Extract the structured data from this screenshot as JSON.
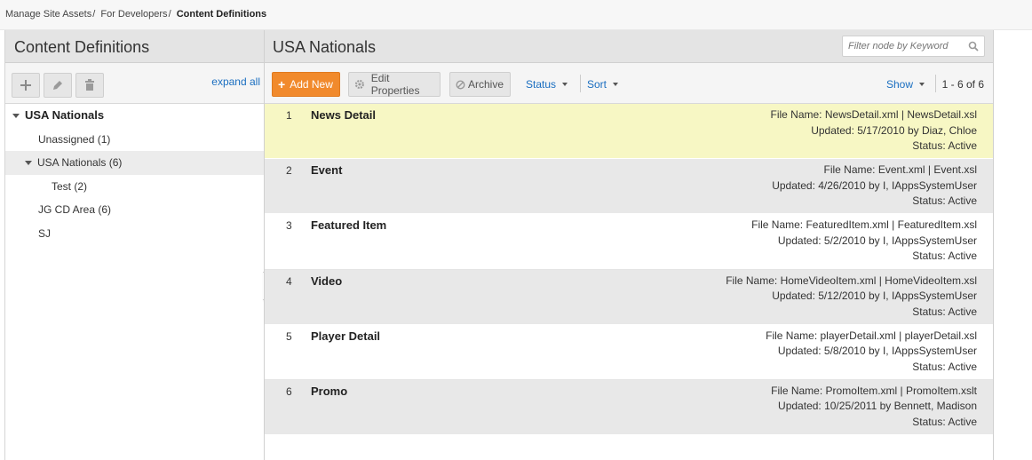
{
  "breadcrumb": {
    "items": [
      "Manage Site Assets",
      "For Developers"
    ],
    "separator": "/",
    "current": "Content Definitions"
  },
  "left": {
    "title": "Content Definitions",
    "toolbar": {
      "add_icon": "plus-icon",
      "edit_icon": "pencil-icon",
      "delete_icon": "trash-icon",
      "expand_all": "expand all"
    },
    "tree": [
      {
        "label": "USA Nationals",
        "level": 0
      },
      {
        "label": "Unassigned (1)",
        "level": 1
      },
      {
        "label": "USA Nationals (6)",
        "level": 1
      },
      {
        "label": "Test (2)",
        "level": 2
      },
      {
        "label": "JG CD Area (6)",
        "level": 1
      },
      {
        "label": "SJ",
        "level": 1
      }
    ]
  },
  "right": {
    "title": "USA Nationals",
    "filter_placeholder": "Filter node by Keyword",
    "toolbar": {
      "add_new": "Add New",
      "edit_properties": "Edit Properties",
      "archive": "Archive",
      "status": "Status",
      "sort": "Sort",
      "show": "Show",
      "pager": "1 - 6 of 6"
    },
    "rows": [
      {
        "num": "1",
        "title": "News Detail",
        "file": "File Name: NewsDetail.xml | NewsDetail.xsl",
        "updated": "Updated: 5/17/2010 by Diaz, Chloe",
        "status": "Status: Active"
      },
      {
        "num": "2",
        "title": "Event",
        "file": "File Name: Event.xml | Event.xsl",
        "updated": "Updated: 4/26/2010 by I, IAppsSystemUser",
        "status": "Status: Active"
      },
      {
        "num": "3",
        "title": "Featured Item",
        "file": "File Name: FeaturedItem.xml | FeaturedItem.xsl",
        "updated": "Updated: 5/2/2010 by I, IAppsSystemUser",
        "status": "Status: Active"
      },
      {
        "num": "4",
        "title": "Video",
        "file": "File Name: HomeVideoItem.xml | HomeVideoItem.xsl",
        "updated": "Updated: 5/12/2010 by I, IAppsSystemUser",
        "status": "Status: Active"
      },
      {
        "num": "5",
        "title": "Player Detail",
        "file": "File Name: playerDetail.xml | playerDetail.xsl",
        "updated": "Updated: 5/8/2010 by I, IAppsSystemUser",
        "status": "Status: Active"
      },
      {
        "num": "6",
        "title": "Promo",
        "file": "File Name: PromoItem.xml | PromoItem.xslt",
        "updated": "Updated: 10/25/2011 by Bennett, Madison",
        "status": "Status: Active"
      }
    ]
  },
  "colors": {
    "accent_orange": "#f18a2c",
    "link_blue": "#1a6ec0",
    "highlight_row": "#f7f7c4",
    "alt_row": "#e8e8e8"
  }
}
